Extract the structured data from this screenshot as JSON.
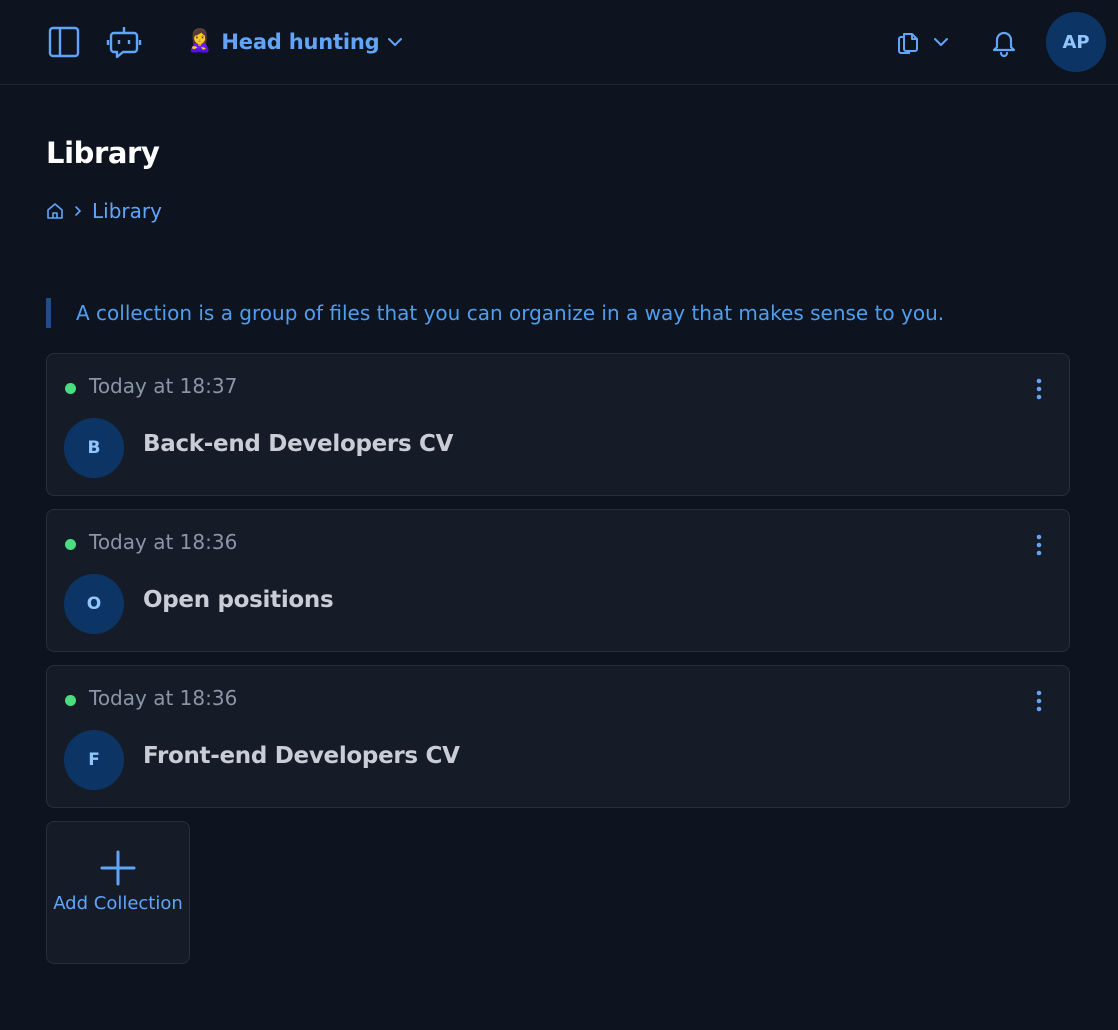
{
  "header": {
    "workspace_emoji": "🙎‍♀️",
    "workspace_name": "Head hunting",
    "user_initials": "AP"
  },
  "page": {
    "title": "Library",
    "breadcrumb": [
      "Library"
    ],
    "info": "A collection is a group of files that you can organize in a way that makes sense to you."
  },
  "collections": [
    {
      "timestamp": "Today at 18:37",
      "initial": "B",
      "name": "Back-end Developers CV"
    },
    {
      "timestamp": "Today at 18:36",
      "initial": "O",
      "name": "Open positions"
    },
    {
      "timestamp": "Today at 18:36",
      "initial": "F",
      "name": "Front-end Developers CV"
    }
  ],
  "add_collection": {
    "label": "Add Collection"
  },
  "colors": {
    "background": "#0d1420",
    "card": "#151c28",
    "accent": "#60a5fa",
    "avatar": "#0c3566",
    "status_green": "#4ade80"
  },
  "icons": [
    "sidebar-toggle-icon",
    "chat-bot-icon",
    "chevron-down-icon",
    "documents-icon",
    "bell-icon",
    "home-icon",
    "chevron-right-icon",
    "more-vertical-icon",
    "plus-icon"
  ]
}
